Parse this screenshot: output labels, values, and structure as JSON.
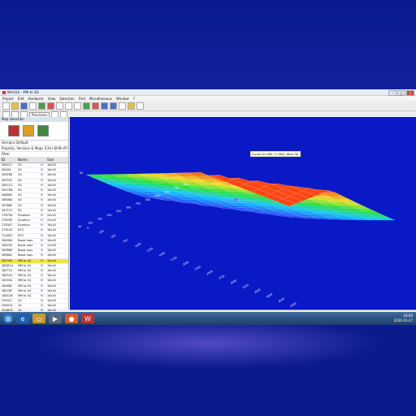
{
  "window": {
    "title": "WinOLS - MM to 3Q"
  },
  "menu": [
    "Project",
    "Edit",
    "Hardware",
    "View",
    "Selection",
    "Find",
    "Miscellaneous",
    "Window",
    "?"
  ],
  "toolbar2": {
    "combo_value": "Processor"
  },
  "left_panel": {
    "title": "Map selection",
    "combo_label": "Versions Default",
    "filter_label": "Projects, Versions & Maps (Ctrl+Shift+P)",
    "filter": "Filter",
    "columns": [
      "ID",
      "Name",
      "",
      "Size"
    ],
    "rows": [
      [
        "264512",
        "5G",
        "M",
        "16x16"
      ],
      [
        "264D4",
        "5G",
        "M",
        "16x16"
      ],
      [
        "265E66",
        "5G",
        "M",
        "16x16"
      ],
      [
        "265354",
        "5G",
        "M",
        "16x16"
      ],
      [
        "265CC2",
        "5G",
        "M",
        "16x16"
      ],
      [
        "2657DB",
        "5G",
        "M",
        "16x16"
      ],
      [
        "266B60",
        "5G",
        "M",
        "16x16"
      ],
      [
        "2680B4",
        "5G",
        "M",
        "16x16"
      ],
      [
        "267B8E",
        "5G",
        "M",
        "16x16"
      ],
      [
        "267FC0",
        "5G",
        "M",
        "16x16"
      ],
      [
        "27B75A",
        "Duration",
        "M",
        "20x16"
      ],
      [
        "27B7B5",
        "Duration",
        "M",
        "20x16"
      ],
      [
        "27B3A7",
        "Duration",
        "M",
        "16x16"
      ],
      [
        "279140",
        "N75",
        "M",
        "16x16"
      ],
      [
        "27A6E5",
        "N75",
        "M",
        "16x16"
      ],
      [
        "28A964",
        "Boost requ",
        "M",
        "16x16"
      ],
      [
        "28B700",
        "Boost requ",
        "M",
        "12x16"
      ],
      [
        "289B68",
        "Boost requ",
        "M",
        "16x16"
      ],
      [
        "289B6C",
        "Boost requ",
        "M",
        "16x16"
      ],
      [
        "28C909",
        "MM to 3Q",
        "M",
        "16x16"
      ],
      [
        "28DD04",
        "MM to 3Q",
        "M",
        "16x16"
      ],
      [
        "28E7C0",
        "MM to 3Q",
        "M",
        "16x16"
      ],
      [
        "28D1FA",
        "MM to 3Q",
        "M",
        "16x16"
      ],
      [
        "2825EA",
        "MM to 3Q",
        "M",
        "16x16"
      ],
      [
        "2846BC",
        "MM to 3Q",
        "M",
        "16x16"
      ],
      [
        "28D7BF",
        "MM to 3Q",
        "M",
        "16x16"
      ],
      [
        "28DC08",
        "MM to 3Q",
        "M",
        "16x16"
      ],
      [
        "293012",
        "CK",
        "M",
        "16x16"
      ],
      [
        "29D974",
        "CK",
        "M",
        "16x16"
      ],
      [
        "2D4DE5",
        "CK",
        "M",
        "16x16"
      ],
      [
        "29E1B0",
        "CK",
        "M",
        "16x16"
      ],
      [
        "29E3A9",
        "CK Lim vs temp",
        "M",
        "8x8"
      ],
      [
        "29C016",
        "CK Lim vs temp",
        "M",
        "8x8"
      ]
    ],
    "selected_index": 19
  },
  "plot": {
    "cursor_label": "Cursor (X=495, Y=780), Value 96",
    "side_label": "81",
    "x_ticks": [
      "0",
      "250",
      "500",
      "750",
      "1000",
      "1250",
      "1500",
      "1750",
      "2000",
      "2250",
      "2500",
      "2750",
      "3000",
      "3250",
      "3500",
      "4000",
      "4500",
      "5000"
    ],
    "y_ticks": [
      "50",
      "100",
      "150",
      "200",
      "250",
      "300",
      "350",
      "400",
      "450",
      "500",
      "550",
      "600"
    ]
  },
  "status": {
    "hint": "Press F1 to receive help.",
    "mode": "No CS",
    "cursor": "Cursor: 28C909 / 1",
    "diff": "0 (0.00%): 58 (...)",
    "zoom": "0 (0.00%), W.Dauw",
    "clock_time": "18:06",
    "clock_date": "2020-01-27"
  },
  "colors": {
    "plot_bg": "#0a19c6",
    "surface_low": "#2030ff",
    "surface_high": "#ff4a1a",
    "selection_row": "#f2e44a"
  }
}
